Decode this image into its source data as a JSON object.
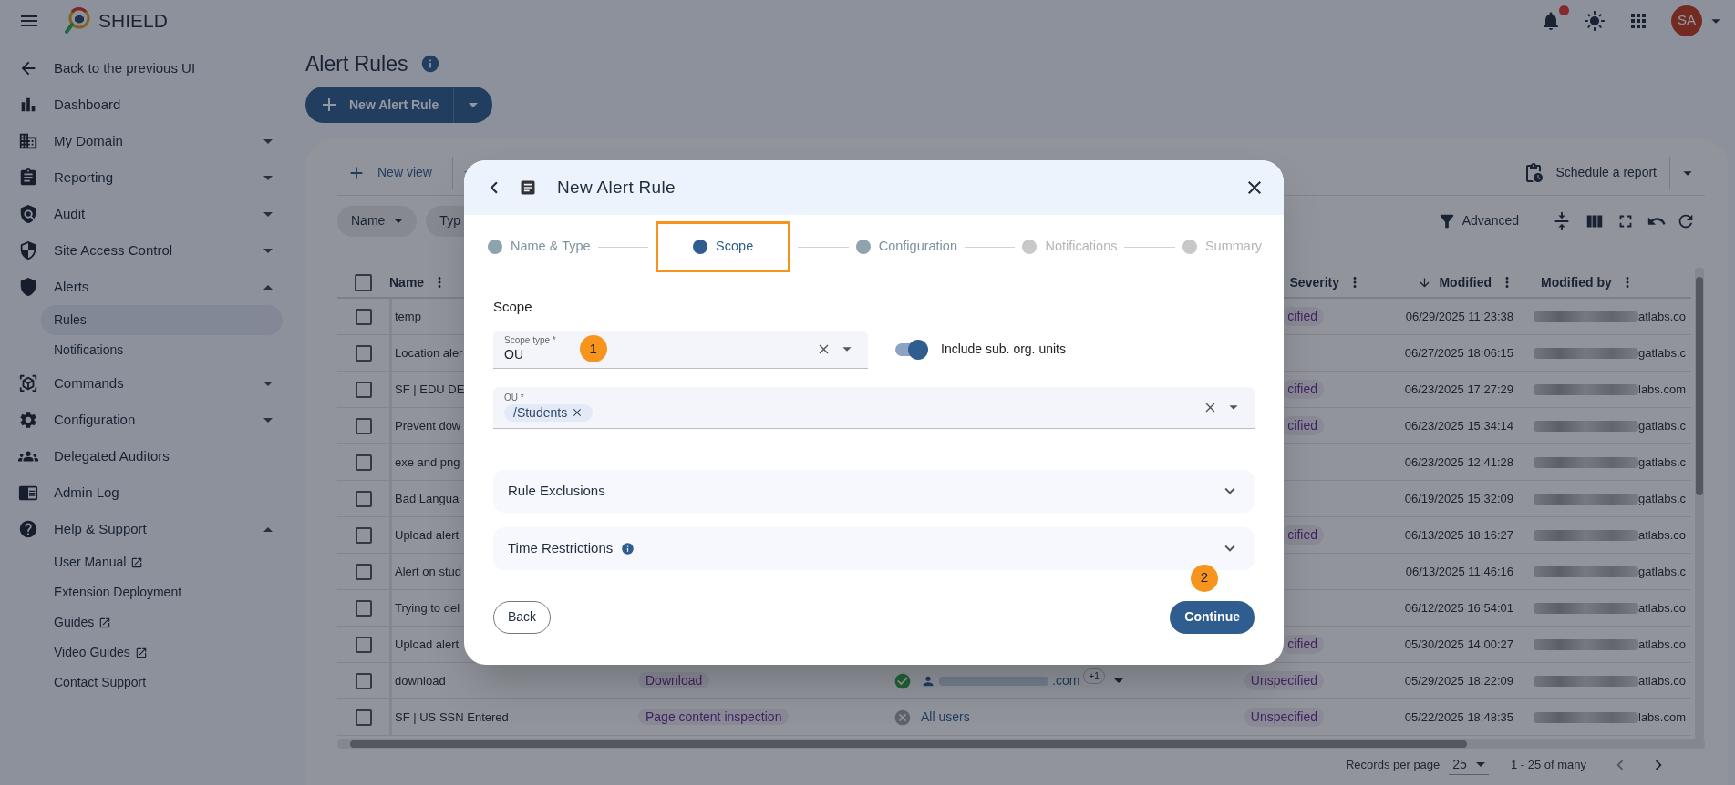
{
  "app": {
    "name": "SHIELD"
  },
  "header": {
    "notification_unread": true,
    "avatar_initials": "SA"
  },
  "sidebar": {
    "items": [
      {
        "label": "Back to the previous UI"
      },
      {
        "label": "Dashboard"
      },
      {
        "label": "My Domain",
        "expanded": false
      },
      {
        "label": "Reporting",
        "expanded": false
      },
      {
        "label": "Audit",
        "expanded": false
      },
      {
        "label": "Site Access Control",
        "expanded": false
      },
      {
        "label": "Alerts",
        "expanded": true,
        "children": [
          {
            "label": "Rules",
            "selected": true,
            "external": false
          },
          {
            "label": "Notifications",
            "selected": false,
            "external": false
          }
        ]
      },
      {
        "label": "Commands",
        "expanded": false
      },
      {
        "label": "Configuration",
        "expanded": false
      },
      {
        "label": "Delegated Auditors"
      },
      {
        "label": "Admin Log"
      },
      {
        "label": "Help & Support",
        "expanded": true,
        "children": [
          {
            "label": "User Manual",
            "selected": false,
            "external": true
          },
          {
            "label": "Extension Deployment",
            "selected": false,
            "external": false
          },
          {
            "label": "Guides",
            "selected": false,
            "external": true
          },
          {
            "label": "Video Guides",
            "selected": false,
            "external": true
          },
          {
            "label": "Contact Support",
            "selected": false,
            "external": false
          }
        ]
      }
    ]
  },
  "page": {
    "title": "Alert Rules",
    "new_button": "New Alert Rule"
  },
  "toolbar": {
    "new_view": "New view",
    "schedule": "Schedule a report",
    "advanced": "Advanced"
  },
  "filters": [
    "Name",
    "Typ"
  ],
  "table": {
    "all_checked": false,
    "columns": [
      "Name",
      "Severity",
      "Modified",
      "Modified by"
    ],
    "rows": [
      {
        "checked": false,
        "name": "temp",
        "severity": "cified",
        "modified": "06/29/2025 11:23:38",
        "modified_by": "atlabs.co"
      },
      {
        "checked": false,
        "name": "Location aler",
        "modified": "06/27/2025 18:06:15",
        "modified_by": "gatlabs.c"
      },
      {
        "checked": false,
        "name": "SF | EDU DE",
        "severity": "cified",
        "modified": "06/23/2025 17:27:29",
        "modified_by": "labs.com"
      },
      {
        "checked": false,
        "name": "Prevent dow",
        "severity": "cified",
        "modified": "06/23/2025 15:34:14",
        "modified_by": "gatlabs.c"
      },
      {
        "checked": false,
        "name": "exe and png",
        "modified": "06/23/2025 12:41:28",
        "modified_by": "gatlabs.c"
      },
      {
        "checked": false,
        "name": "Bad Langua",
        "modified": "06/19/2025 15:32:09",
        "modified_by": "gatlabs.c"
      },
      {
        "checked": false,
        "name": "Upload alert",
        "severity": "cified",
        "modified": "06/13/2025 18:16:27",
        "modified_by": "atlabs.co"
      },
      {
        "checked": false,
        "name": "Alert on stud",
        "modified": "06/13/2025 11:46:16",
        "modified_by": "gatlabs.c"
      },
      {
        "checked": false,
        "name": "Trying to del",
        "modified": "06/12/2025 16:54:01",
        "modified_by": "atlabs.co"
      },
      {
        "checked": false,
        "name": "Upload alert",
        "severity": "cified",
        "modified": "05/30/2025 14:00:27",
        "modified_by": "atlabs.co"
      },
      {
        "checked": false,
        "name": "download",
        "type": "Download",
        "enabled": true,
        "scope": ".com",
        "scope_more": "+1",
        "severity": "Unspecified",
        "modified": "05/29/2025 18:22:09",
        "modified_by": "atlabs.co"
      },
      {
        "checked": false,
        "name": "SF | US SSN Entered",
        "type": "Page content inspection",
        "enabled": false,
        "scope": "All users",
        "severity": "Unspecified",
        "modified": "05/22/2025 18:48:35",
        "modified_by": "labs.com"
      }
    ]
  },
  "pagination": {
    "label": "Records per page",
    "per_page": "25",
    "range": "1 - 25 of many"
  },
  "dialog": {
    "title": "New Alert Rule",
    "steps": [
      {
        "label": "Name & Type",
        "done": true,
        "selected": false
      },
      {
        "label": "Scope",
        "selected": true
      },
      {
        "label": "Configuration",
        "done": true,
        "selected": false
      },
      {
        "label": "Notifications",
        "done": false,
        "selected": false
      },
      {
        "label": "Summary",
        "done": false,
        "selected": false
      }
    ],
    "section": "Scope",
    "scope_type": {
      "label": "Scope type *",
      "value": "OU"
    },
    "include_sub": {
      "label": "Include sub. org. units",
      "on": true
    },
    "ou": {
      "label": "OU *",
      "chips": [
        "/Students"
      ]
    },
    "accordions": [
      {
        "label": "Rule Exclusions",
        "info": false,
        "expanded": false
      },
      {
        "label": "Time Restrictions",
        "info": true,
        "expanded": false
      }
    ],
    "back": "Back",
    "continue": "Continue",
    "markers": [
      "1",
      "2"
    ]
  }
}
